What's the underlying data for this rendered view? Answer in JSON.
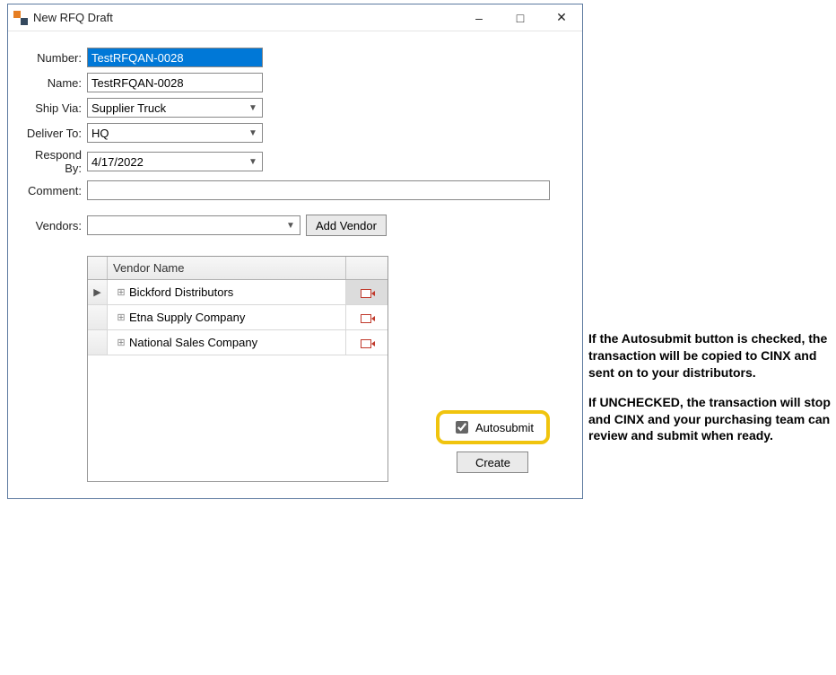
{
  "window": {
    "title": "New RFQ Draft"
  },
  "form": {
    "number": {
      "label": "Number:",
      "value": "TestRFQAN-0028"
    },
    "name": {
      "label": "Name:",
      "value": "TestRFQAN-0028"
    },
    "ship_via": {
      "label": "Ship Via:",
      "value": "Supplier Truck"
    },
    "deliver_to": {
      "label": "Deliver To:",
      "value": "HQ"
    },
    "respond_by": {
      "label": "Respond By:",
      "value": "4/17/2022"
    },
    "comment": {
      "label": "Comment:",
      "value": ""
    },
    "vendors_label": "Vendors:",
    "add_vendor": "Add Vendor"
  },
  "grid": {
    "header_name": "Vendor Name",
    "rows": [
      {
        "name": "Bickford Distributors",
        "selected": true
      },
      {
        "name": "Etna Supply Company",
        "selected": false
      },
      {
        "name": "National Sales Company",
        "selected": false
      }
    ]
  },
  "controls": {
    "autosubmit_label": "Autosubmit",
    "autosubmit_checked": true,
    "create_label": "Create"
  },
  "annotation": {
    "p1": "If the Autosubmit button is checked, the transaction will be copied to CINX and sent on to your distributors.",
    "p2": "If UNCHECKED, the transaction will stop and CINX and your purchasing team can review and submit when ready."
  }
}
